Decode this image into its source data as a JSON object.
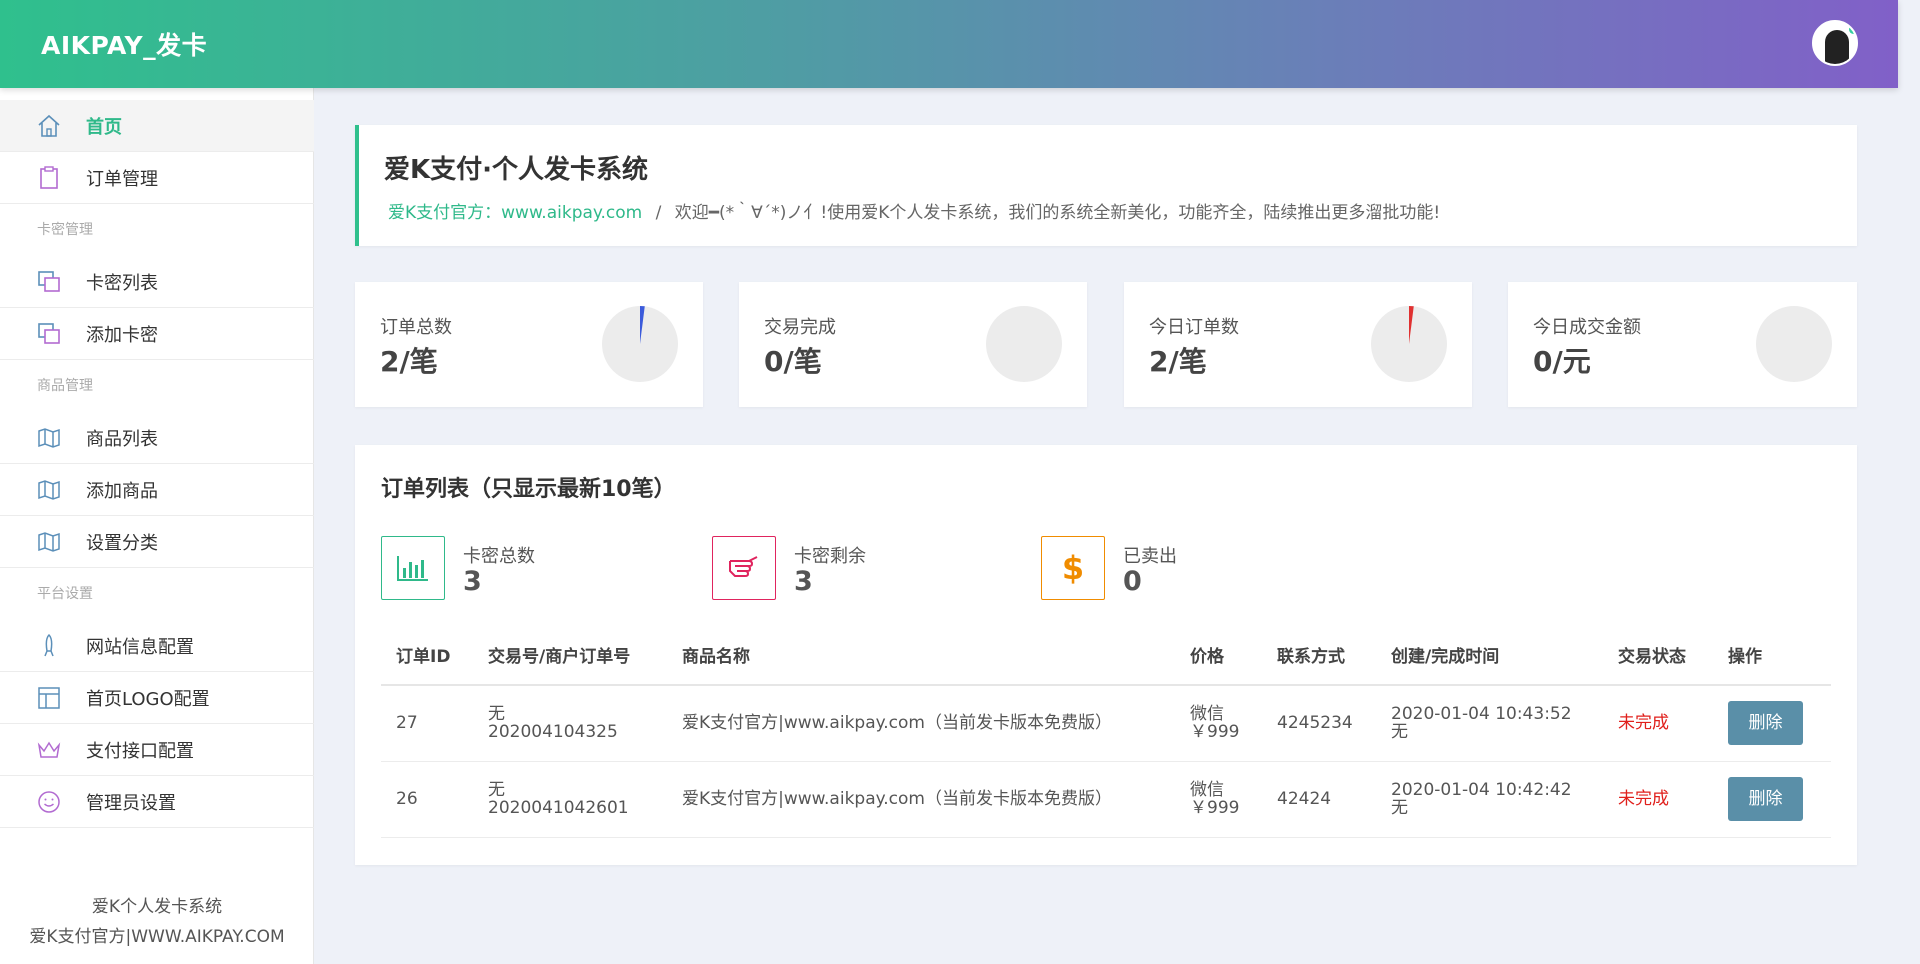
{
  "header": {
    "brand": "AIKPAY_发卡"
  },
  "sidebar": {
    "items": [
      {
        "label": "首页"
      },
      {
        "label": "订单管理"
      },
      {
        "group": "卡密管理"
      },
      {
        "label": "卡密列表"
      },
      {
        "label": "添加卡密"
      },
      {
        "group": "商品管理"
      },
      {
        "label": "商品列表"
      },
      {
        "label": "添加商品"
      },
      {
        "label": "设置分类"
      },
      {
        "group": "平台设置"
      },
      {
        "label": "网站信息配置"
      },
      {
        "label": "首页LOGO配置"
      },
      {
        "label": "支付接口配置"
      },
      {
        "label": "管理员设置"
      }
    ],
    "footer_line1": "爱K个人发卡系统",
    "footer_line2": "爱K支付官方|WWW.AIKPAY.COM"
  },
  "welcome": {
    "title": "爱K支付·个人发卡系统",
    "link": "爱K支付官方：www.aikpay.com",
    "separator": "/",
    "message": "欢迎━(*｀∀´*)ノ亻!使用爱K个人发卡系统，我们的系统全新美化，功能齐全，陆续推出更多溜批功能!"
  },
  "stats": [
    {
      "label": "订单总数",
      "value": "2/笔",
      "fraction": 0.02,
      "color": "#3b5bdb"
    },
    {
      "label": "交易完成",
      "value": "0/笔",
      "fraction": 0,
      "color": "#3b5bdb"
    },
    {
      "label": "今日订单数",
      "value": "2/笔",
      "fraction": 0.02,
      "color": "#e03131"
    },
    {
      "label": "今日成交金额",
      "value": "0/元",
      "fraction": 0,
      "color": "#3b5bdb"
    }
  ],
  "orders": {
    "title": "订单列表（只显示最新10笔）",
    "summary": [
      {
        "label": "卡密总数",
        "value": "3",
        "icon": "bar-chart-icon",
        "color": "#2fb98a"
      },
      {
        "label": "卡密剩余",
        "value": "3",
        "icon": "pointing-hand-icon",
        "color": "#e0245e"
      },
      {
        "label": "已卖出",
        "value": "0",
        "icon": "dollar-icon",
        "color": "#f08c00"
      }
    ],
    "columns": [
      "订单ID",
      "交易号/商户订单号",
      "商品名称",
      "价格",
      "联系方式",
      "创建/完成时间",
      "交易状态",
      "操作"
    ],
    "rows": [
      {
        "id": "27",
        "trade_no": "无",
        "merchant_no": "202004104325",
        "product": "爱K支付官方|www.aikpay.com（当前发卡版本免费版）",
        "pay": "微信",
        "price": "￥999",
        "contact": "4245234",
        "created": "2020-01-04 10:43:52",
        "finished": "无",
        "status": "未完成",
        "action": "删除"
      },
      {
        "id": "26",
        "trade_no": "无",
        "merchant_no": "2020041042601",
        "product": "爱K支付官方|www.aikpay.com（当前发卡版本免费版）",
        "pay": "微信",
        "price": "￥999",
        "contact": "42424",
        "created": "2020-01-04 10:42:42",
        "finished": "无",
        "status": "未完成",
        "action": "删除"
      }
    ]
  }
}
